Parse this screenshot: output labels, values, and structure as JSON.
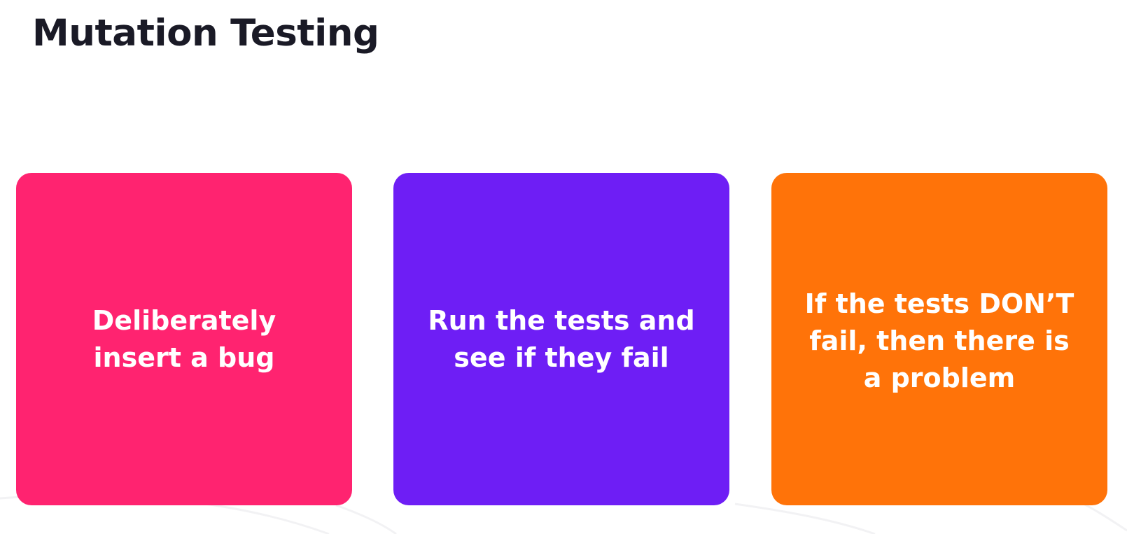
{
  "slide": {
    "title": "Mutation Testing",
    "title_color": "#1a1a26",
    "background_color": "#ffffff"
  },
  "cards": [
    {
      "color": "#ff2370",
      "lines": [
        "Deliberately",
        "insert a bug"
      ]
    },
    {
      "color": "#6e1ef5",
      "lines": [
        "Run the tests and",
        "see if they fail"
      ]
    },
    {
      "color": "#ff7309",
      "lines": [
        "If the tests DON’T",
        "fail, then there is",
        "a problem"
      ]
    }
  ]
}
